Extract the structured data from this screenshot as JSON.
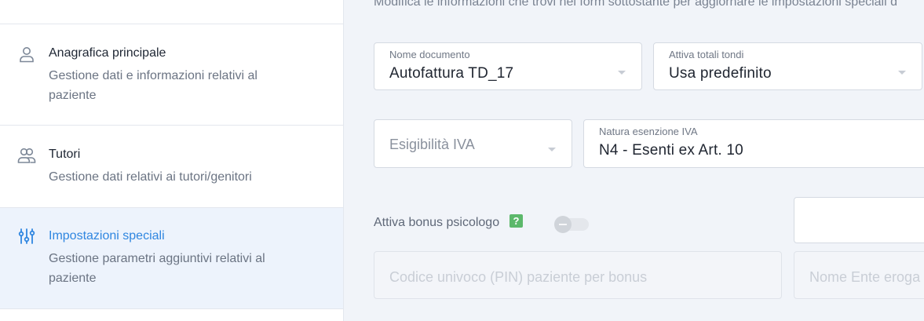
{
  "sidebar": {
    "items": [
      {
        "icon": "user-icon",
        "title": "Anagrafica principale",
        "desc": "Gestione dati e informazioni relativi al paziente",
        "active": false
      },
      {
        "icon": "users-icon",
        "title": "Tutori",
        "desc": "Gestione dati relativi ai tutori/genitori",
        "active": false
      },
      {
        "icon": "sliders-icon",
        "title": "Impostazioni speciali",
        "desc": "Gestione parametri aggiuntivi relativi al paziente",
        "active": true
      }
    ]
  },
  "main": {
    "intro": "Modifica le informazioni che trovi nei form sottostante per aggiornare le impostazioni speciali d",
    "nome_documento": {
      "label": "Nome documento",
      "value": "Autofattura TD_17"
    },
    "attiva_totali_tondi": {
      "label": "Attiva totali tondi",
      "value": "Usa predefinito"
    },
    "esigibilita_iva": {
      "placeholder": "Esigibilità IVA"
    },
    "natura_esenzione": {
      "label": "Natura esenzione IVA",
      "value": "N4 - Esenti ex Art. 10"
    },
    "bonus": {
      "label": "Attiva bonus psicologo",
      "help": "?",
      "enabled": false
    },
    "pin_field": {
      "placeholder": "Codice univoco (PIN) paziente per bonus"
    },
    "ente_field": {
      "placeholder": "Nome Ente eroga"
    }
  },
  "colors": {
    "accent": "#2f86e0",
    "help_badge": "#5cb86b",
    "active_bg": "#edf3fc"
  }
}
